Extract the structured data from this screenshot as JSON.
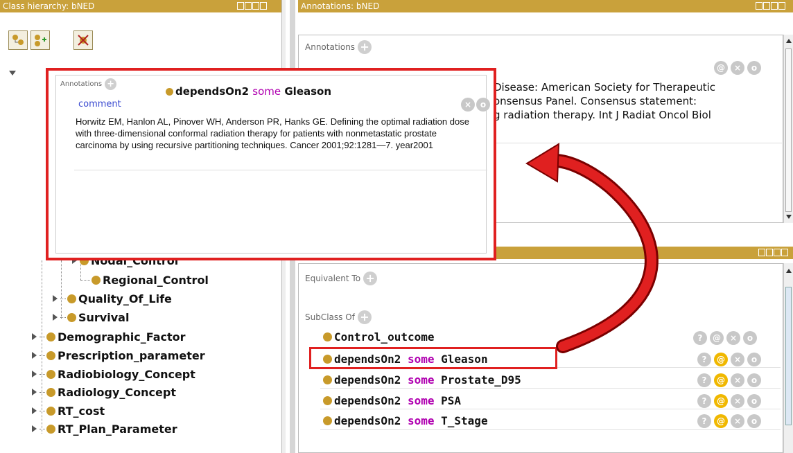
{
  "left_panel": {
    "title": "Class hierarchy: bNED",
    "tree": {
      "nodal_control": "Nodal_Control",
      "regional_control": "Regional_Control",
      "quality_of_life": "Quality_Of_Life",
      "survival": "Survival",
      "demographic_factor": "Demographic_Factor",
      "prescription_parameter": "Prescription_parameter",
      "radiobiology_concept": "Radiobiology_Concept",
      "radiology_concept": "Radiology_Concept",
      "rt_cost": "RT_cost",
      "rt_plan_parameter": "RT_Plan_Parameter"
    }
  },
  "annotations_panel": {
    "title": "Annotations: bNED",
    "label": "Annotations",
    "text_lines": [
      "Disease:  American Society for Therapeutic",
      "onsensus Panel. Consensus statement:",
      "g radiation therapy. Int J Radiat Oncol Biol"
    ]
  },
  "description_panel": {
    "equivalent_to": "Equivalent To",
    "subclass_of": "SubClass Of",
    "axioms": [
      {
        "prefix": "Control_outcome",
        "keyword": "",
        "suffix": ""
      },
      {
        "prefix": "dependsOn2",
        "keyword": "some",
        "suffix": "Gleason"
      },
      {
        "prefix": "dependsOn2",
        "keyword": "some",
        "suffix": "Prostate_D95"
      },
      {
        "prefix": "dependsOn2",
        "keyword": "some",
        "suffix": "PSA"
      },
      {
        "prefix": "dependsOn2",
        "keyword": "some",
        "suffix": "T_Stage"
      }
    ]
  },
  "popup": {
    "label": "Annotations",
    "axiom_prefix": "dependsOn2",
    "axiom_keyword": "some",
    "axiom_suffix": "Gleason",
    "property": "comment",
    "text": "Horwitz EM, Hanlon AL, Pinover WH, Anderson PR, Hanks GE. Defining the optimal radiation dose with three-dimensional conformal radiation therapy for patients with nonmetastatic prostate carcinoma by using recursive partitioning techniques. Cancer 2001;92:1281—7. year2001"
  },
  "icons": {
    "help": "?",
    "annotate": "@",
    "delete": "×",
    "edit": "o",
    "add": "+"
  },
  "colors": {
    "title_bar": "#c9a13b",
    "highlight": "#e02020",
    "keyword": "#b000b0",
    "class_bullet": "#c89a2a",
    "active_icon": "#f0b800"
  }
}
